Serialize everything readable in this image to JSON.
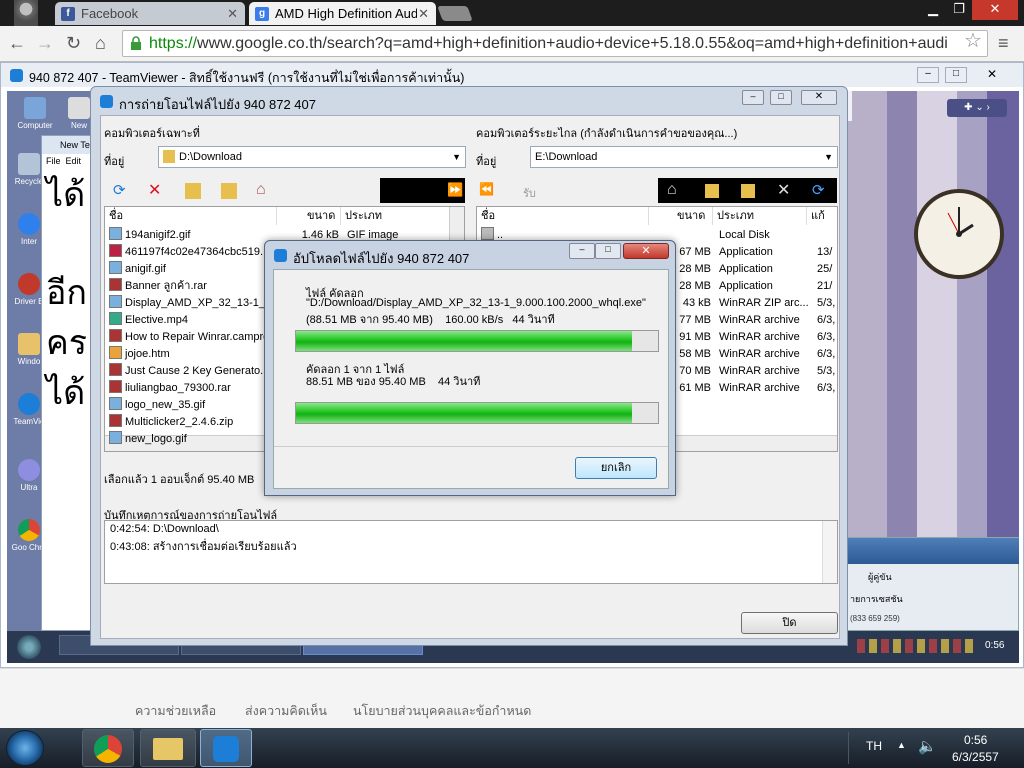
{
  "browser": {
    "tabs": [
      {
        "label": "Facebook"
      },
      {
        "label": "AMD High Definition Aud"
      }
    ],
    "url_scheme": "https://",
    "url_rest": "www.google.co.th/search?q=amd+high+definition+audio+device+5.18.0.55&oq=amd+high+definition+audi"
  },
  "teamviewer": {
    "window_title": "940 872 407 - TeamViewer - สิทธิ์ใช้งานฟรี (การใช้งานที่ไม่ใช่เพื่อการค้าเท่านั้น)",
    "desktop_icons": [
      "Computer",
      "New",
      "Recycle",
      "Inter",
      "Driver E",
      "Windo",
      "TeamVie",
      "Ultra",
      "Goo Chro"
    ],
    "notepad_title": "New Te",
    "notepad_menu": [
      "File",
      "Edit"
    ],
    "notepad_text": [
      "ได้",
      "อีก",
      "คร",
      "ได้"
    ],
    "remote_clock_time": "0:56"
  },
  "file_transfer": {
    "title": "การถ่ายโอนไฟล์ไปยัง 940 872 407",
    "local": {
      "header": "คอมพิวเตอร์เฉพาะที่",
      "location_label": "ที่อยู่",
      "location": "D:\\Download",
      "columns": [
        "ชื่อ",
        "ขนาด",
        "ประเภท"
      ],
      "files": [
        {
          "name": "194anigif2.gif",
          "size": "1.46 kB",
          "type": "GIF image"
        },
        {
          "name": "461197f4c02e47364cbc519...",
          "size": "",
          "type": ""
        },
        {
          "name": "anigif.gif",
          "size": "",
          "type": ""
        },
        {
          "name": "Banner ลูกค้า.rar",
          "size": "",
          "type": ""
        },
        {
          "name": "Display_AMD_XP_32_13-1_...",
          "size": "",
          "type": ""
        },
        {
          "name": "Elective.mp4",
          "size": "",
          "type": ""
        },
        {
          "name": "How to Repair Winrar.campro",
          "size": "",
          "type": ""
        },
        {
          "name": "jojoe.htm",
          "size": "",
          "type": ""
        },
        {
          "name": "Just Cause 2 Key Generato...",
          "size": "",
          "type": ""
        },
        {
          "name": "liuliangbao_79300.rar",
          "size": "",
          "type": ""
        },
        {
          "name": "logo_new_35.gif",
          "size": "",
          "type": ""
        },
        {
          "name": "Multiclicker2_2.4.6.zip",
          "size": "",
          "type": ""
        },
        {
          "name": "new_logo.gif",
          "size": "",
          "type": ""
        }
      ],
      "selection_status": "เลือกแล้ว 1 ออบเจ็กต์ 95.40 MB"
    },
    "remote": {
      "header": "คอมพิวเตอร์ระยะไกล (กำลังดำเนินการคำขอของคุณ...)",
      "location_label": "ที่อยู่",
      "location": "E:\\Download",
      "receive_label": "รับ",
      "columns": [
        "ชื่อ",
        "ขนาด",
        "ประเภท",
        "แก้"
      ],
      "files": [
        {
          "name": "..",
          "size": "",
          "type": "Local Disk",
          "mod": ""
        },
        {
          "name": "",
          "size": "67 MB",
          "type": "Application",
          "mod": "13/"
        },
        {
          "name": "",
          "size": "28 MB",
          "type": "Application",
          "mod": "25/"
        },
        {
          "name": "",
          "size": "28 MB",
          "type": "Application",
          "mod": "21/"
        },
        {
          "name": "",
          "size": "43 kB",
          "type": "WinRAR ZIP arc...",
          "mod": "5/3,"
        },
        {
          "name": "",
          "size": "77 MB",
          "type": "WinRAR archive",
          "mod": "6/3,"
        },
        {
          "name": "",
          "size": "91 MB",
          "type": "WinRAR archive",
          "mod": "6/3,"
        },
        {
          "name": "",
          "size": "58 MB",
          "type": "WinRAR archive",
          "mod": "6/3,"
        },
        {
          "name": "",
          "size": "70 MB",
          "type": "WinRAR archive",
          "mod": "5/3,"
        },
        {
          "name": "",
          "size": "61 MB",
          "type": "WinRAR archive",
          "mod": "6/3,"
        }
      ]
    },
    "log": {
      "header": "บันทึกเหตุการณ์ของการถ่ายโอนไฟล์",
      "lines": [
        "0:42:54: D:\\Download\\",
        "0:43:08: สร้างการเชื่อมต่อเรียบร้อยแล้ว"
      ]
    },
    "close_label": "ปิด"
  },
  "upload_dialog": {
    "title": "อัปโหลดไฟล์ไปยัง 940 872 407",
    "file_label": "ไฟล์ คัดลอก",
    "file_path": "\"D:/Download/Display_AMD_XP_32_13-1_9.000.100.2000_whql.exe\"",
    "file_stats": "(88.51 MB จาก 95.40 MB)    160.00 kB/s   44 วินาที",
    "file_progress": 0.9278,
    "total_label": "คัดลอก 1 จาก 1 ไฟล์",
    "total_stats": "88.51 MB ของ 95.40 MB    44 วินาที",
    "total_progress": 0.9278,
    "cancel_label": "ยกเลิก"
  },
  "remote_panel": {
    "user_label": "ผู้คู่ขัน",
    "section": "ายการเซสชัน",
    "id_text": "(833 659 259)"
  },
  "footer_links": [
    "ความช่วยเหลือ",
    "ส่งความคิดเห็น",
    "นโยบายส่วนบุคคลและข้อกำหนด"
  ],
  "taskbar": {
    "language": "TH",
    "time": "0:56",
    "date": "6/3/2557"
  }
}
